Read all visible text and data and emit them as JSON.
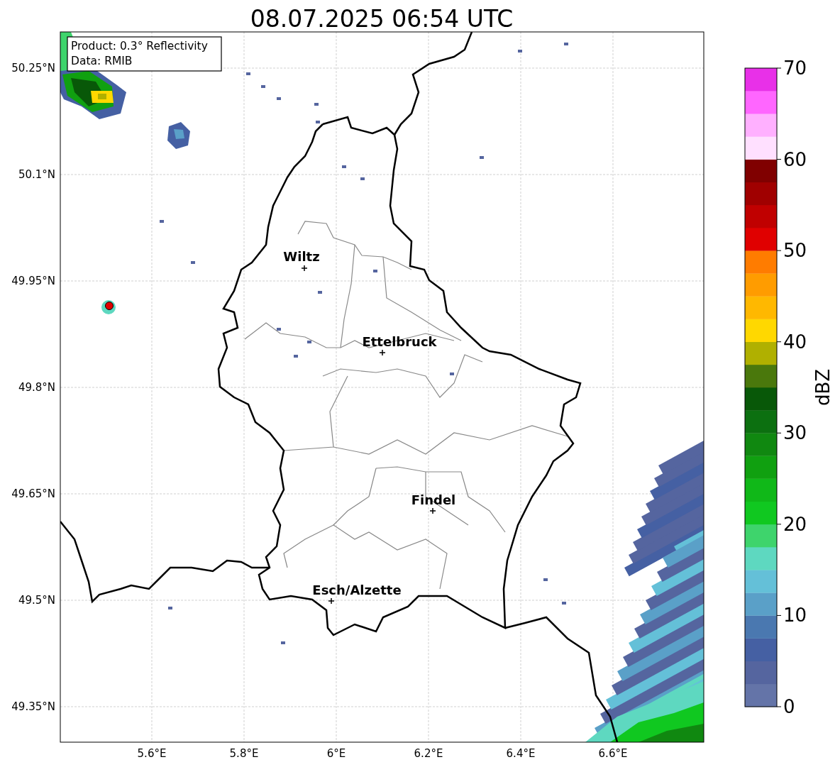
{
  "title": "08.07.2025 06:54 UTC",
  "info_box": {
    "lines": [
      "Product: 0.3° Reflectivity",
      "Data: RMIB"
    ]
  },
  "map": {
    "lat_ticks": [
      "50.25°N",
      "50.1°N",
      "49.95°N",
      "49.8°N",
      "49.65°N",
      "49.5°N",
      "49.35°N"
    ],
    "lon_ticks": [
      "5.6°E",
      "5.8°E",
      "6°E",
      "6.2°E",
      "6.4°E",
      "6.6°E"
    ],
    "cities": [
      {
        "name": "Wiltz"
      },
      {
        "name": "Ettelbruck"
      },
      {
        "name": "Findel"
      },
      {
        "name": "Esch/Alzette"
      }
    ]
  },
  "colorbar": {
    "label": "dBZ",
    "ticks": [
      "70",
      "60",
      "50",
      "40",
      "30",
      "20",
      "10",
      "0"
    ],
    "bins": [
      {
        "color": "#6474a8"
      },
      {
        "color": "#55659f"
      },
      {
        "color": "#4560a3"
      },
      {
        "color": "#4a78b0"
      },
      {
        "color": "#5aa0c8"
      },
      {
        "color": "#64c0d8"
      },
      {
        "color": "#5ed8c0"
      },
      {
        "color": "#3ed46c"
      },
      {
        "color": "#10c820"
      },
      {
        "color": "#10b818"
      },
      {
        "color": "#10a010"
      },
      {
        "color": "#108810"
      },
      {
        "color": "#0c7010"
      },
      {
        "color": "#085808"
      },
      {
        "color": "#4a780c"
      },
      {
        "color": "#b0b000"
      },
      {
        "color": "#ffd800"
      },
      {
        "color": "#ffb800"
      },
      {
        "color": "#ff9c00"
      },
      {
        "color": "#ff7c00"
      },
      {
        "color": "#e00000"
      },
      {
        "color": "#c00000"
      },
      {
        "color": "#a00000"
      },
      {
        "color": "#800000"
      },
      {
        "color": "#ffe0ff"
      },
      {
        "color": "#ffb0ff"
      },
      {
        "color": "#ff66ff"
      },
      {
        "color": "#e830e8"
      }
    ]
  }
}
